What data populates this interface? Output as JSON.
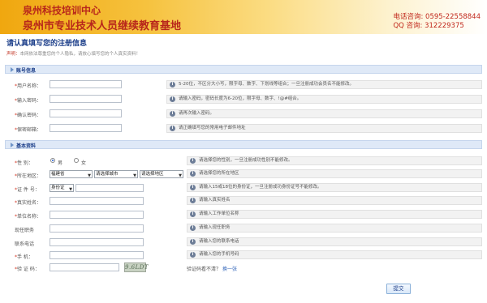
{
  "banner": {
    "org_name": "泉州科技培训中心",
    "org_subtitle": "泉州市专业技术人员继续教育基地",
    "phone_label": "电话咨询:",
    "phone": "0595-22558844",
    "qq_label": "QQ 咨询:",
    "qq": "312229375"
  },
  "page": {
    "heading": "请认真填写您的注册信息",
    "notice_label": "声明：",
    "notice_text": "本网依法尊重您的个人隐私，请放心填写您的个人真实资料！"
  },
  "account_section": {
    "title": "账号信息",
    "fields": [
      {
        "label": "用户名称：",
        "required": "*",
        "hint": "5-20位，不区分大小写，限字母、数字、下划线等组合；一旦注册成功会员名不能修改。"
      },
      {
        "label": "输入密码：",
        "required": "*",
        "hint": "请输入密码，密码长度为6-20位，限字母、数字、!@#组合。"
      },
      {
        "label": "确认密码：",
        "required": "*",
        "hint": "请再次输入密码。"
      },
      {
        "label": "保密邮箱：",
        "required": "*",
        "hint": "请正确填写您的常用电子邮件地址"
      }
    ]
  },
  "basic_section": {
    "title": "基本资料",
    "gender": {
      "label": "性    别：",
      "required": "*",
      "male": "男",
      "female": "女",
      "selected": "男",
      "hint": "请选择您的性别，一旦注册成功性别不能修改。"
    },
    "region": {
      "label": "所在地区：",
      "required": "*",
      "province": "福建省",
      "city": "请选择城市",
      "district": "请选择地区",
      "hint": "请选择您的所在地区"
    },
    "id_doc": {
      "label": "证 件 号：",
      "required": "*",
      "type": "身份证",
      "hint": "请输入15或18位的身份证，一旦注册成功身份证号不能修改。"
    },
    "real_name": {
      "label": "真实姓名：",
      "required": "*",
      "hint": "请输入真实姓名"
    },
    "company": {
      "label": "单位名称：",
      "required": "*",
      "hint": "请输入工作单位名称"
    },
    "position": {
      "label": "现任职务",
      "required": "",
      "hint": "请输入现任职务"
    },
    "phone": {
      "label": "联系电话",
      "required": "",
      "hint": "请输入您的联系电话"
    },
    "mobile": {
      "label": "手    机：",
      "required": "*",
      "hint": "请输入您的手机号码"
    },
    "captcha": {
      "label": "验 证 码：",
      "required": "*",
      "code": "9.6LDT",
      "hint_text": "验证码看不清？",
      "refresh_text": "换一张"
    }
  },
  "submit_label": "提交"
}
